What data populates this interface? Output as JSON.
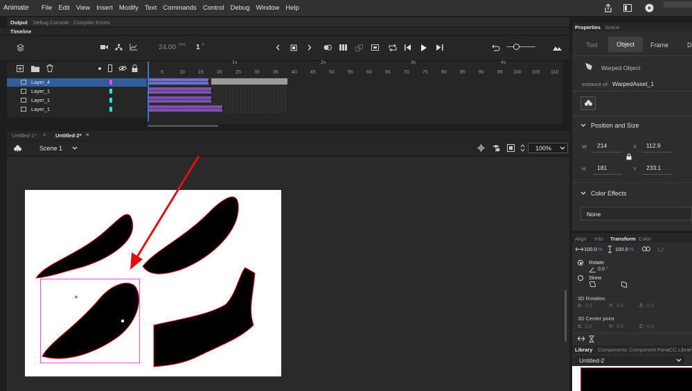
{
  "app_name": "Animate",
  "menu": [
    "File",
    "Edit",
    "View",
    "Insert",
    "Modify",
    "Text",
    "Commands",
    "Control",
    "Debug",
    "Window",
    "Help"
  ],
  "bottom_tabs": [
    "Output",
    "Debug Console",
    "Compiler Errors"
  ],
  "timeline": {
    "title": "Timeline",
    "fps": "24.00",
    "fps_unit": "FPS",
    "frame": "1",
    "frame_unit": "F",
    "ruler_ticks": [
      "5",
      "10",
      "15",
      "20",
      "25",
      "30",
      "35",
      "40",
      "45",
      "50",
      "55",
      "60",
      "65",
      "70",
      "75",
      "80",
      "85",
      "90",
      "95",
      "100",
      "105",
      "110"
    ],
    "time_marks": [
      "1s",
      "2s",
      "3s",
      "4s"
    ],
    "layers": [
      {
        "name": "Layer_4",
        "color": "#ff40ff",
        "selected": true
      },
      {
        "name": "Layer_1",
        "color": "#30e0e0",
        "selected": false
      },
      {
        "name": "Layer_1",
        "color": "#30e0e0",
        "selected": false
      },
      {
        "name": "Layer_1",
        "color": "#30e0e0",
        "selected": false
      }
    ]
  },
  "doc_tabs": [
    {
      "label": "Untitled-1*",
      "active": false
    },
    {
      "label": "Untitled-2*",
      "active": true
    }
  ],
  "scene": {
    "label": "Scene 1",
    "zoom": "100%"
  },
  "properties": {
    "tabs": [
      "Properties",
      "Scene"
    ],
    "mode_tabs": [
      "Tool",
      "Object",
      "Frame",
      "D"
    ],
    "object_type": "Warped Object",
    "instance_of_label": "Instance of:",
    "instance_of": "WarpedAsset_1",
    "position_size_title": "Position and Size",
    "w_label": "W",
    "w": "214",
    "h_label": "H",
    "h": "181",
    "x_label": "X",
    "x": "112.9",
    "y_label": "Y",
    "y": "233.1",
    "color_effects_title": "Color Effects",
    "color_effect_value": "None"
  },
  "transform_panel": {
    "tabs": [
      "Align",
      "Info",
      "Transform",
      "Color"
    ],
    "scale_w": "100.0",
    "scale_h": "100.0",
    "unit": "%",
    "rotate_label": "Rotate",
    "rotate_value": "0.0",
    "deg": "°",
    "skew_label": "Skew",
    "skew_a": "-",
    "skew_b": "-",
    "rotation3d_title": "3D Rotation",
    "rotation3d": {
      "x": "0.0",
      "y": "0.0",
      "z": "0.0"
    },
    "center3d_title": "3D Center point",
    "center3d": {
      "x": "0.0",
      "y": "0.0",
      "z": "0.0"
    },
    "axis_x": "X:",
    "axis_y": "Y:",
    "axis_z": "Z:"
  },
  "library": {
    "tabs": [
      "Library",
      "Components",
      "Component Parar",
      "CC Libraries"
    ],
    "selected_doc": "Untitled-2"
  },
  "colors": {
    "accent": "#2f5f96",
    "arrow": "#e01010",
    "selection": "#ff40ff",
    "stroke": "#e02020"
  }
}
